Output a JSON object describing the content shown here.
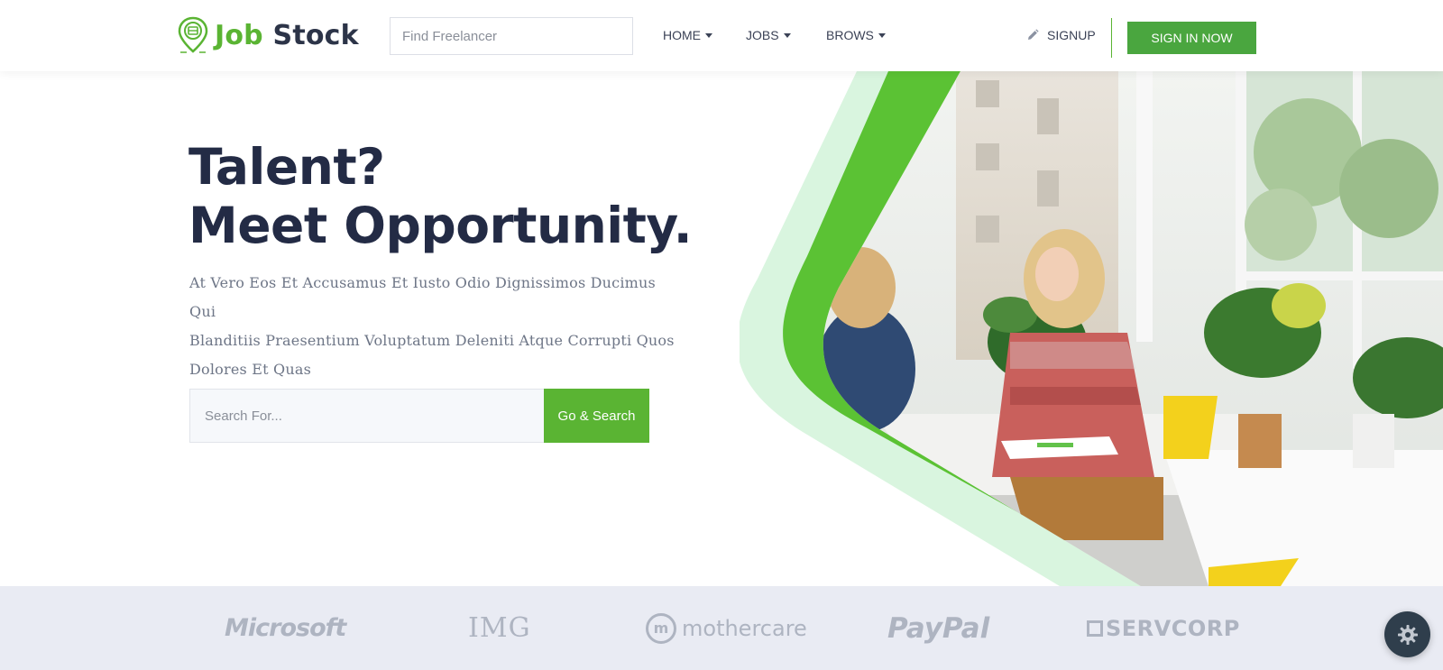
{
  "header": {
    "logo": {
      "word1": "Job",
      "word2": "Stock"
    },
    "search": {
      "placeholder": "Find Freelancer"
    },
    "nav": [
      {
        "label": "HOME"
      },
      {
        "label": "JOBS"
      },
      {
        "label": "BROWS"
      }
    ],
    "signup_label": "SIGNUP",
    "signin_label": "SIGN IN NOW"
  },
  "hero": {
    "headline_line1": "Talent?",
    "headline_line2": "Meet Opportunity.",
    "lead_line1": "At Vero Eos Et Accusamus Et Iusto Odio Dignissimos Ducimus Qui",
    "lead_line2": "Blanditiis Praesentium Voluptatum Deleniti Atque Corrupti Quos",
    "lead_line3": "Dolores Et Quas",
    "search_placeholder": "Search For...",
    "search_button": "Go & Search"
  },
  "partners": [
    {
      "name": "Microsoft"
    },
    {
      "name": "IMG"
    },
    {
      "name": "mothercare"
    },
    {
      "name": "PayPal"
    },
    {
      "name": "SERVCORP"
    }
  ],
  "colors": {
    "accent": "#5ab433",
    "button_green": "#4aa63f",
    "heading": "#232b45",
    "partner_strip": "#e9ebf3",
    "fab": "#2f3e4c"
  },
  "icons": {
    "logo": "map-pin-icon",
    "signup": "pencil-icon",
    "fab": "gear-icon"
  }
}
